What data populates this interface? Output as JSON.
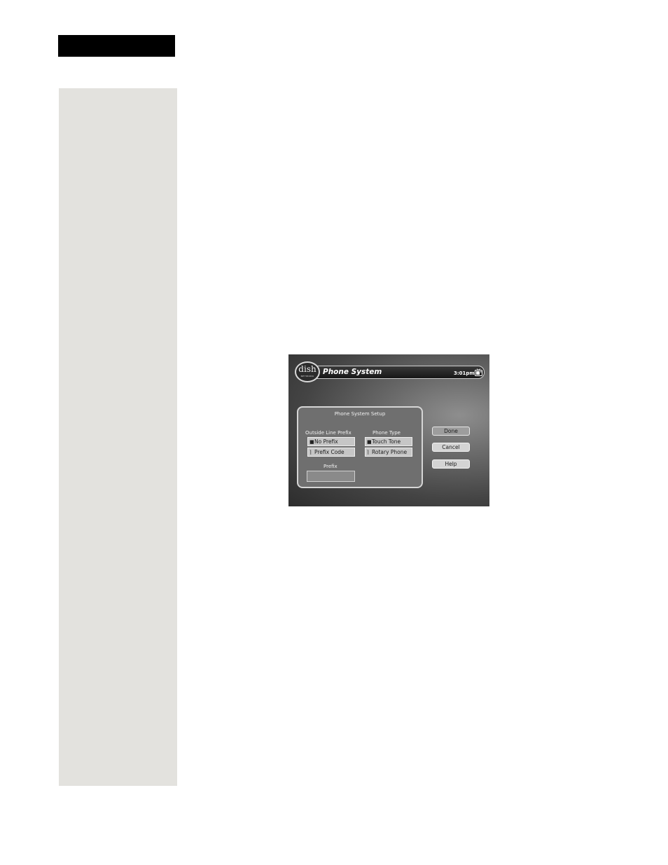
{
  "window": {
    "title": "Phone System",
    "clock": "3:01pm",
    "logo_text": "dish",
    "logo_subtext": "NETWORK"
  },
  "dialog": {
    "title": "Phone System Setup",
    "outside_line_prefix": {
      "label": "Outside Line Prefix",
      "options": [
        {
          "label": "No Prefix",
          "selected": true
        },
        {
          "label": "Prefix Code",
          "selected": false
        }
      ]
    },
    "phone_type": {
      "label": "Phone Type",
      "options": [
        {
          "label": "Touch Tone",
          "selected": true
        },
        {
          "label": "Rotary Phone",
          "selected": false
        }
      ]
    },
    "prefix": {
      "label": "Prefix",
      "value": ""
    }
  },
  "buttons": {
    "done": "Done",
    "cancel": "Cancel",
    "help": "Help"
  },
  "icons": {
    "selected_mark": "■",
    "unselected_mark": "⌉"
  }
}
